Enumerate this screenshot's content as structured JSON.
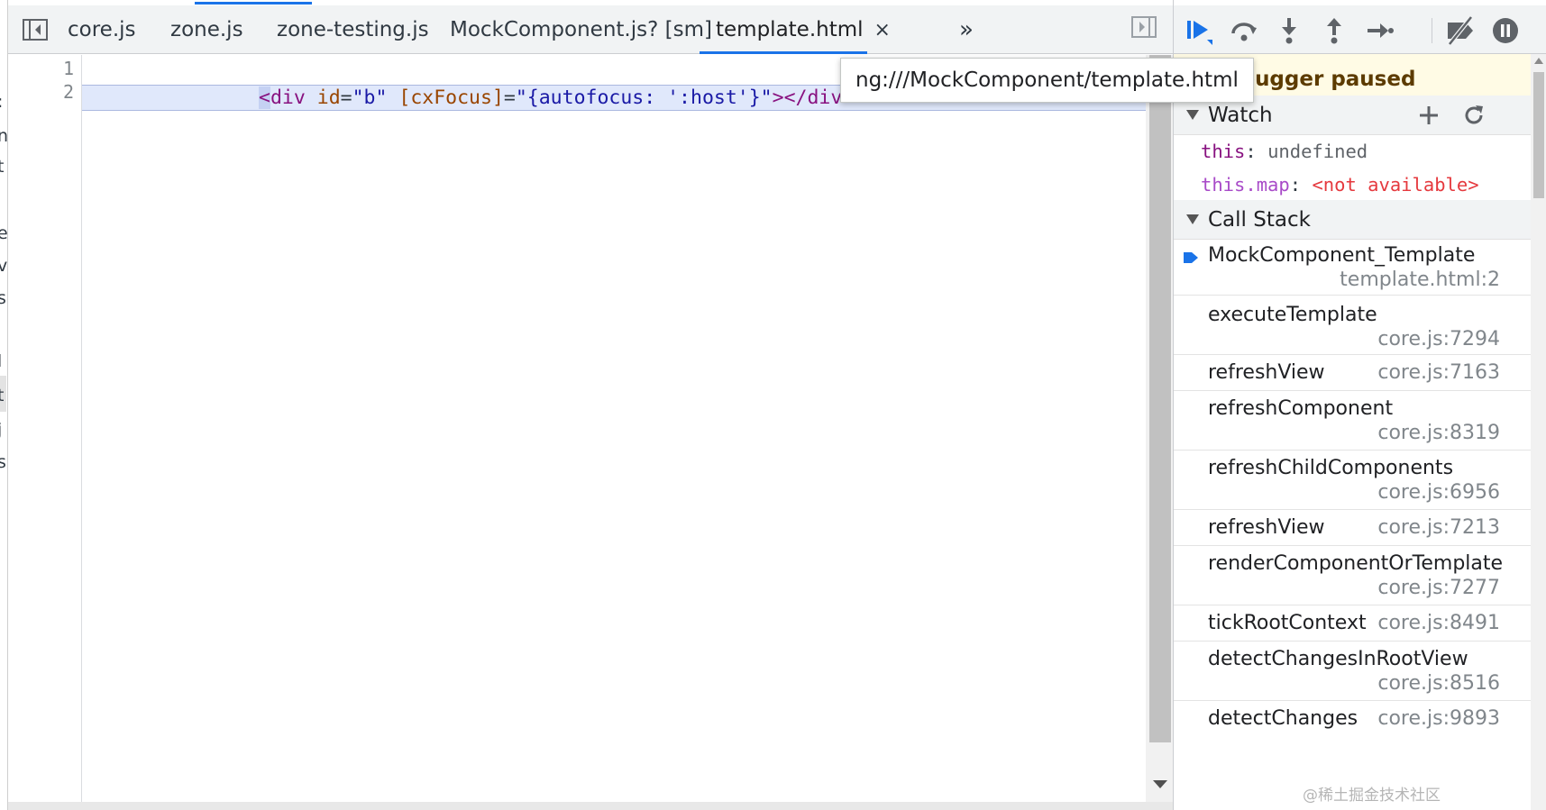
{
  "left_panel": {
    "fragments": [
      ":",
      "n",
      "t",
      "e",
      "ve",
      "s",
      "l",
      "t",
      "j",
      "s"
    ]
  },
  "editor": {
    "tabs": [
      {
        "label": "core.js"
      },
      {
        "label": "zone.js"
      },
      {
        "label": "zone-testing.js"
      },
      {
        "label": "MockComponent.js? [sm]"
      },
      {
        "label": "template.html",
        "active": true,
        "close": "×"
      }
    ],
    "more_tabs": "»",
    "line_numbers": [
      "1",
      "2"
    ],
    "code": {
      "open_bracket": "<",
      "tag": "div",
      "attr1": "id",
      "eq1": "=",
      "val1": "\"b\"",
      "attr2": "[cxFocus]",
      "eq2": "=",
      "val2": "\"{autofocus: ':host'}\"",
      "close": "></div>"
    },
    "tooltip": "ng:///MockComponent/template.html"
  },
  "debugger": {
    "paused_label": "ebugger paused",
    "watch": {
      "title": "Watch",
      "items": [
        {
          "key": "this",
          "value": "undefined"
        },
        {
          "key": "this.map",
          "value": "<not available>"
        }
      ]
    },
    "call_stack": {
      "title": "Call Stack",
      "frames": [
        {
          "fn": "MockComponent_Template",
          "loc": "template.html:2",
          "current": true
        },
        {
          "fn": "executeTemplate",
          "loc": "core.js:7294"
        },
        {
          "fn": "refreshView",
          "loc": "core.js:7163"
        },
        {
          "fn": "refreshComponent",
          "loc": "core.js:8319"
        },
        {
          "fn": "refreshChildComponents",
          "loc": "core.js:6956"
        },
        {
          "fn": "refreshView",
          "loc": "core.js:7213"
        },
        {
          "fn": "renderComponentOrTemplate",
          "loc": "core.js:7277"
        },
        {
          "fn": "tickRootContext",
          "loc": "core.js:8491"
        },
        {
          "fn": "detectChangesInRootView",
          "loc": "core.js:8516"
        },
        {
          "fn": "detectChanges",
          "loc": "core.js:9893"
        }
      ]
    }
  },
  "watermark": "@稀土掘金技术社区",
  "colors": {
    "accent": "#1a73e8",
    "paused_bg": "#fffbe5",
    "tag": "#881280",
    "attr": "#994500",
    "value": "#1a1aa6",
    "error": "#e5393e"
  }
}
